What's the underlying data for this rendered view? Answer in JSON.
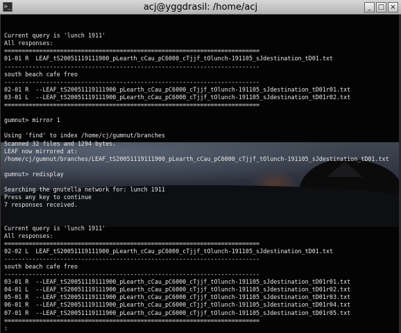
{
  "window": {
    "title": "acj@yggdrasil: /home/acj",
    "app_icon": "terminal-icon",
    "controls": {
      "minimize": "_",
      "maximize": "□",
      "close": "×"
    }
  },
  "terminal": {
    "lines": [
      "",
      "",
      "Current query is 'lunch 1911'",
      "All responses:",
      "=========================================================================",
      "01-01 R  LEAF_tS20051119111900_pLearth_cCau_pC6000_cTjjf_tOlunch-191105_sJdestination_tD01.txt",
      "-------------------------------------------------------------------------",
      "south beach cafe freo",
      "-------------------------------------------------------------------------",
      "02-01 R  --LEAF_tS20051119111900_pLearth_cCau_pC6000_cTjjf_tOlunch-191105_sJdestination_tD01r01.txt",
      "03-01 L  --LEAF_tS20051119111900_pLearth_cCau_pC6000_cTjjf_tOlunch-191105_sJdestination_tD01r02.txt",
      "=========================================================================",
      "",
      "gumnut> mirror 1",
      "",
      "Using 'find' to index /home/cj/gumnut/branches",
      "Scanned 32 files and 1294 bytes.",
      "LEAF now mirrored at:",
      "/home/cj/gumnut/branches/LEAF_tS20051119111900_pLearth_cCau_pC6000_cTjjf_tOlunch-191105_sJdestination_tD01.txt",
      "",
      "gumnut> redisplay",
      "",
      "Searching the gnutella network for: lunch 1911",
      "Press any key to continue",
      "7 responses received.",
      "",
      "",
      "Current query is 'lunch 1911'",
      "All responses:",
      "=========================================================================",
      "02-02 L  LEAF_tS20051119111900_pLearth_cCau_pC6000_cTjjf_tOlunch-191105_sJdestination_tD01.txt",
      "-------------------------------------------------------------------------",
      "south beach cafe freo",
      "-------------------------------------------------------------------------",
      "03-01 R  --LEAF_tS20051119111900_pLearth_cCau_pC6000_cTjjf_tOlunch-191105_sJdestination_tD01r01.txt",
      "04-01 L  --LEAF_tS20051119111900_pLearth_cCau_pC6000_cTjjf_tOlunch-191105_sJdestination_tD01r02.txt",
      "05-01 R  --LEAF_tS20051119111900_pLearth_cCau_pC6000_cTjjf_tOlunch-191105_sJdestination_tD01r03.txt",
      "06-01 R  --LEAF_tS20051119111900_pLearth_cCau_pC6000_cTjjf_tOlunch-191105_sJdestination_tD01r04.txt",
      "07-01 R  --LEAF_tS20051119111900_pLearth_cCau_pC6000_cTjjf_tOlunch-191105_sJdestination_tD01r05.txt",
      "=========================================================================",
      ":"
    ]
  },
  "colors": {
    "titlebar": "#c8c8c8",
    "terminal_bg": "#040404",
    "text": "#e8e8e8"
  }
}
